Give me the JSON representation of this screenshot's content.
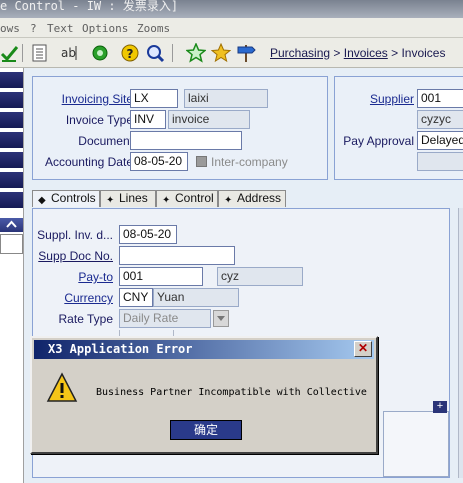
{
  "window": {
    "title": "e Control - IW : 发票录入]"
  },
  "menu": {
    "items": [
      "ows",
      "? ",
      "Text",
      "Options",
      "Zooms"
    ]
  },
  "breadcrumb": {
    "part1": "Purchasing",
    "sep1": " > ",
    "part2": "Invoices",
    "sep2": " > ",
    "part3": "Invoices"
  },
  "header": {
    "invoicing_site": {
      "label": "Invoicing Site",
      "code": "LX",
      "name": "laixi"
    },
    "invoice_type": {
      "label": "Invoice Type",
      "code": "INV",
      "name": "invoice"
    },
    "document": {
      "label": "Document",
      "value": ""
    },
    "accounting_date": {
      "label": "Accounting Date",
      "value": "08-05-20"
    },
    "intercompany": {
      "label": "Inter-company"
    },
    "supplier": {
      "label": "Supplier",
      "code": "001",
      "name": "cyzyc"
    },
    "pay_approval": {
      "label": "Pay Approval",
      "value": "Delayed"
    }
  },
  "tabs": [
    {
      "label": "Controls",
      "icon": "diamond-icon"
    },
    {
      "label": "Lines",
      "icon": "arrow-icon"
    },
    {
      "label": "Control",
      "icon": "arrow-icon"
    },
    {
      "label": "Address",
      "icon": "arrow-icon"
    }
  ],
  "controls": {
    "suppl_inv_date": {
      "label": "Suppl. Inv. d...",
      "value": "08-05-20"
    },
    "supp_doc_no": {
      "label": "Supp Doc No.",
      "value": ""
    },
    "pay_to": {
      "label": "Pay-to",
      "code": "001",
      "name": "cyz"
    },
    "currency": {
      "label": "Currency",
      "code": "CNY",
      "name": "Yuan"
    },
    "rate_type": {
      "label": "Rate Type",
      "value": "Daily Rate"
    }
  },
  "dialog": {
    "title": "X3 Application Error",
    "message": "Business Partner Incompatible with Collective",
    "ok_label": "确定"
  }
}
